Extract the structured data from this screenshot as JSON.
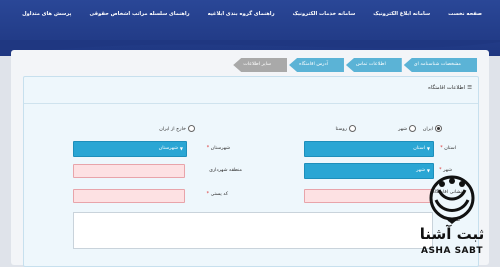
{
  "topnav": {
    "items": [
      {
        "label": "صفحه نخست"
      },
      {
        "label": "سامانه ابلاغ الکترونیک"
      },
      {
        "label": "سامانه خدمات الکترونیک"
      },
      {
        "label": "راهنمای گروه بندی ابلاغیه"
      },
      {
        "label": "راهنمای سلسله مراتب اشخاص حقوقی"
      },
      {
        "label": "پرسش های متداول"
      }
    ]
  },
  "steps": [
    {
      "label": "مشخصات شناسنامه ای"
    },
    {
      "label": "اطلاعات تماس"
    },
    {
      "label": "آدرس اقامتگاه"
    },
    {
      "label": "سایر اطلاعات"
    }
  ],
  "panel": {
    "title": "اطلاعات اقامتگاه",
    "title_icon": "bars-icon"
  },
  "form": {
    "iran_outside": {
      "option_iran": "ایران",
      "option_outside": "خارج از ایران"
    },
    "city_village": {
      "option_city": "شهر",
      "option_village": "روستا"
    },
    "province": {
      "label": "استان",
      "value": "استان"
    },
    "county": {
      "label": "شهرستان",
      "value": "شهرستان"
    },
    "city_type": {
      "label": "شهر",
      "value": "شهر"
    },
    "municipal_zone": {
      "label": "منطقه شهرداری",
      "value": ""
    },
    "residence_address": {
      "label": "نشانی اقامتگاه",
      "value": ""
    },
    "postal_code": {
      "label": "کد پستی",
      "value": ""
    },
    "address": {
      "label": "نشانی",
      "value": ""
    }
  },
  "watermark": {
    "brand_fa": "ثبت آشنا",
    "brand_en": "ASHA SABT"
  },
  "colors": {
    "nav_bg": "#243e8c",
    "step_active": "#5bb3d6",
    "step_inactive": "#a9a9a9",
    "select_bg": "#2aa6d4",
    "required_input_bg": "#fde1e3"
  }
}
